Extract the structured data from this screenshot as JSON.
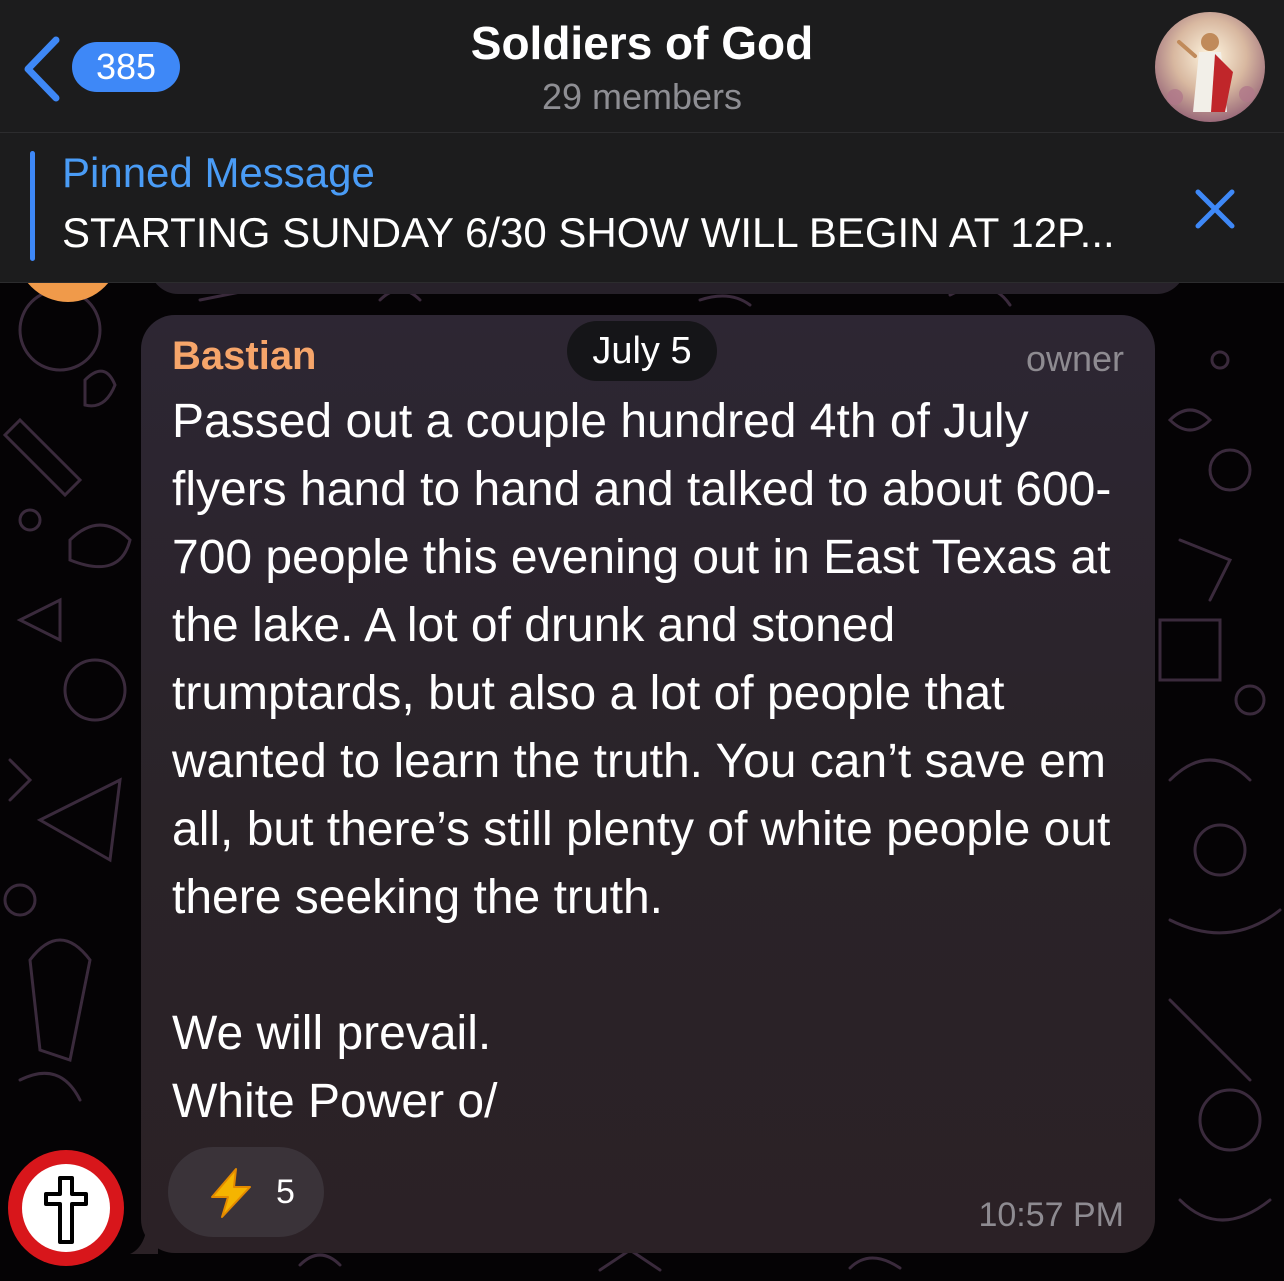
{
  "header": {
    "back_count": "385",
    "title": "Soldiers of God",
    "subtitle": "29 members"
  },
  "pinned": {
    "label": "Pinned Message",
    "text": "STARTING SUNDAY 6/30 SHOW WILL BEGIN AT 12P..."
  },
  "message": {
    "date": "July 5",
    "sender": "Bastian",
    "role": "owner",
    "text": "Passed out a couple hundred 4th of July flyers hand to hand and talked to about 600-700 people this evening out in East Texas at the lake. A lot of drunk and stoned trumptards, but also a lot of people that wanted to learn the truth. You can’t save em all, but there’s still plenty of white people out there seeking the truth.\n\nWe will prevail.\nWhite Power o/",
    "reaction": {
      "emoji": "lightning-icon",
      "count": "5"
    },
    "time": "10:57 PM"
  },
  "colors": {
    "accent": "#3e88f7",
    "sender_name": "#f6a56a",
    "bubble": "#2b2428"
  }
}
